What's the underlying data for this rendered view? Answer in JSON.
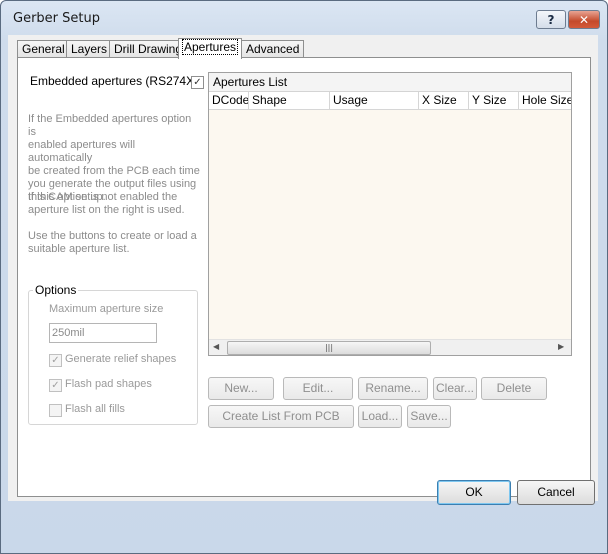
{
  "window": {
    "title": "Gerber Setup",
    "help_label": "?",
    "close_label": "✕"
  },
  "tabs": [
    {
      "label": "General"
    },
    {
      "label": "Layers"
    },
    {
      "label": "Drill Drawing"
    },
    {
      "label": "Apertures"
    },
    {
      "label": "Advanced"
    }
  ],
  "embedded": {
    "label": "Embedded apertures (RS274X)",
    "checked": true,
    "check_glyph": "✓"
  },
  "help_text": {
    "p1": [
      "If the Embedded apertures option is",
      "enabled apertures will automatically",
      "be created from the PCB each time",
      "you generate the output files using",
      "this CAM setup."
    ],
    "p2": [
      "If this option is not enabled the",
      "aperture list on the right is used."
    ],
    "p3": [
      "Use the buttons to create or load a",
      "suitable aperture list."
    ]
  },
  "options": {
    "title": "Options",
    "max_aperture_label": "Maximum aperture size",
    "max_aperture_value": "250mil",
    "generate_relief": {
      "label": "Generate relief shapes",
      "checked": true,
      "glyph": "✓"
    },
    "flash_pad": {
      "label": "Flash pad shapes",
      "checked": true,
      "glyph": "✓"
    },
    "flash_all": {
      "label": "Flash all fills",
      "checked": false,
      "glyph": ""
    }
  },
  "apertures_list": {
    "title": "Apertures List",
    "columns": [
      "DCode",
      "Shape",
      "Usage",
      "X Size",
      "Y Size",
      "Hole Size"
    ],
    "rows": [],
    "scroll_grip": "|||"
  },
  "buttons": {
    "new": "New...",
    "edit": "Edit...",
    "rename": "Rename...",
    "clear": "Clear...",
    "delete": "Delete",
    "create_list": "Create List From PCB",
    "load": "Load...",
    "save": "Save..."
  },
  "footer": {
    "ok": "OK",
    "cancel": "Cancel"
  }
}
